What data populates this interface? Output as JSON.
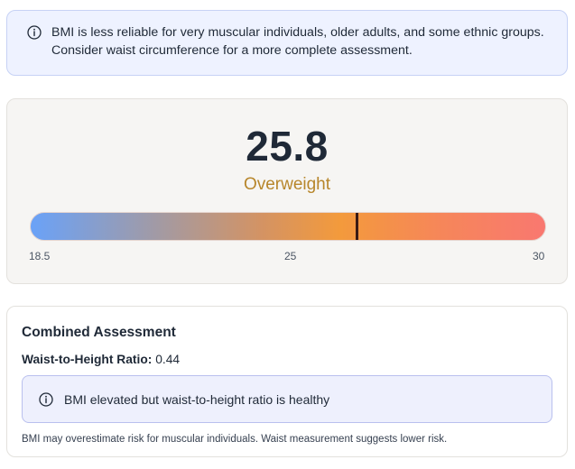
{
  "info_banner": {
    "icon": "info-icon",
    "line1": "BMI is less reliable for very muscular individuals, older adults, and some ethnic groups.",
    "line2": "Consider waist circumference for a more complete assessment."
  },
  "bmi_result": {
    "value": "25.8",
    "category": "Overweight",
    "category_color": "#b7862b",
    "scale": {
      "min_label": "18.5",
      "mid_label": "25",
      "max_label": "30",
      "min": 18.5,
      "max": 30,
      "marker_value": 25.8
    }
  },
  "assessment": {
    "title": "Combined Assessment",
    "ratio_label": "Waist-to-Height Ratio:",
    "ratio_value": "0.44",
    "alert_icon": "info-icon",
    "alert_text": "BMI elevated but waist-to-height ratio is healthy",
    "note": "BMI may overestimate risk for muscular individuals. Waist measurement suggests lower risk."
  }
}
